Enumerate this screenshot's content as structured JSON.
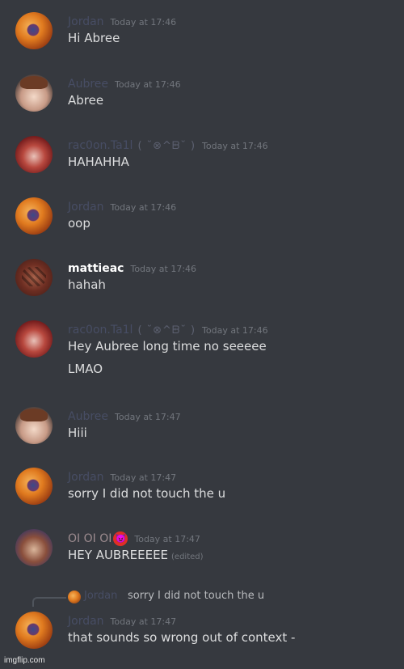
{
  "messages": [
    {
      "name": "Jordan",
      "timestamp": "Today at 17:46",
      "lines": [
        "Hi Abree"
      ]
    },
    {
      "name": "Aubree",
      "timestamp": "Today at 17:46",
      "lines": [
        "Abree"
      ]
    },
    {
      "name": "rac0on.Ta1l",
      "emote": "( ˘⊗^ᗸ˘ )",
      "timestamp": "Today at 17:46",
      "lines": [
        "HAHAHHA"
      ]
    },
    {
      "name": "Jordan",
      "timestamp": "Today at 17:46",
      "lines": [
        "oop"
      ]
    },
    {
      "name": "mattieac",
      "timestamp": "Today at 17:46",
      "lines": [
        "hahah"
      ]
    },
    {
      "name": "rac0on.Ta1l",
      "emote": "( ˘⊗^ᗸ˘ )",
      "timestamp": "Today at 17:46",
      "lines": [
        "Hey Aubree long time no seeeee",
        "LMAO"
      ]
    },
    {
      "name": "Aubree",
      "timestamp": "Today at 17:47",
      "lines": [
        "Hiii"
      ]
    },
    {
      "name": "Jordan",
      "timestamp": "Today at 17:47",
      "lines": [
        "sorry I did not touch the u"
      ]
    },
    {
      "name": "OI OI OI",
      "badge": "devil-emoji",
      "timestamp": "Today at 17:47",
      "lines": [
        "HEY AUBREEEEE"
      ],
      "edited": "(edited)"
    },
    {
      "name": "Jordan",
      "timestamp": "Today at 17:47",
      "lines": [
        "that sounds so wrong out of context -"
      ]
    }
  ],
  "reply": {
    "name": "Jordan",
    "text": "sorry I did not touch the u"
  },
  "watermark": "imgflip.com"
}
